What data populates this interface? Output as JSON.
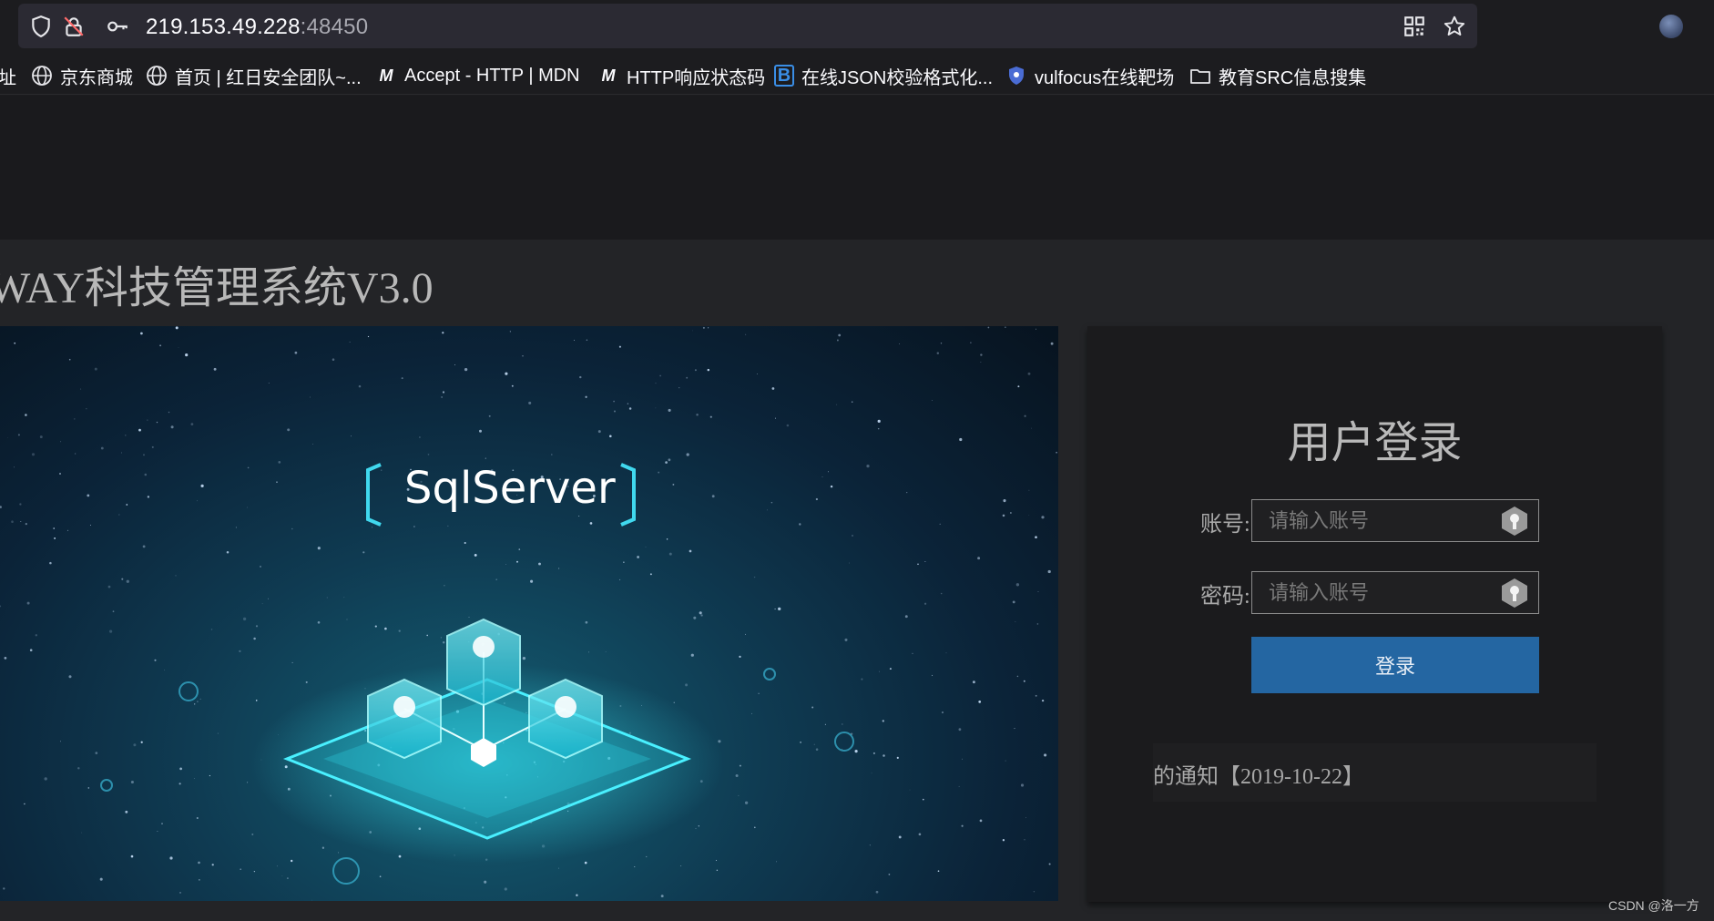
{
  "browser": {
    "url_host": "219.153.49.228",
    "url_port": ":48450",
    "icons": [
      "shield-icon",
      "lock-slash-icon",
      "key-icon",
      "qr-code-icon",
      "star-icon",
      "profile-avatar"
    ]
  },
  "bookmarks": [
    {
      "label": "址",
      "icon": "none"
    },
    {
      "label": "京东商城",
      "icon": "globe-icon"
    },
    {
      "label": "首页 | 红日安全团队~...",
      "icon": "globe-icon"
    },
    {
      "label": "Accept - HTTP | MDN",
      "icon": "mdn-icon"
    },
    {
      "label": "HTTP响应状态码",
      "icon": "mdn-icon"
    },
    {
      "label": "在线JSON校验格式化...",
      "icon": "bejson-icon"
    },
    {
      "label": "vulfocus在线靶场",
      "icon": "shield-badge-icon"
    },
    {
      "label": "教育SRC信息搜集",
      "icon": "folder-icon"
    }
  ],
  "page": {
    "system_title": "WAY科技管理系统V3.0",
    "banner_text": "SqlServer"
  },
  "login": {
    "title": "用户登录",
    "account_label": "账号:",
    "account_placeholder": "请输入账号",
    "password_label": "密码:",
    "password_placeholder": "请输入账号",
    "submit_label": "登录",
    "notice": "的通知【2019-10-22】"
  },
  "watermark": "CSDN @洛一方",
  "colors": {
    "button": "#2466a2",
    "page_bg": "#232427",
    "panel_bg": "#1b1b1d"
  }
}
